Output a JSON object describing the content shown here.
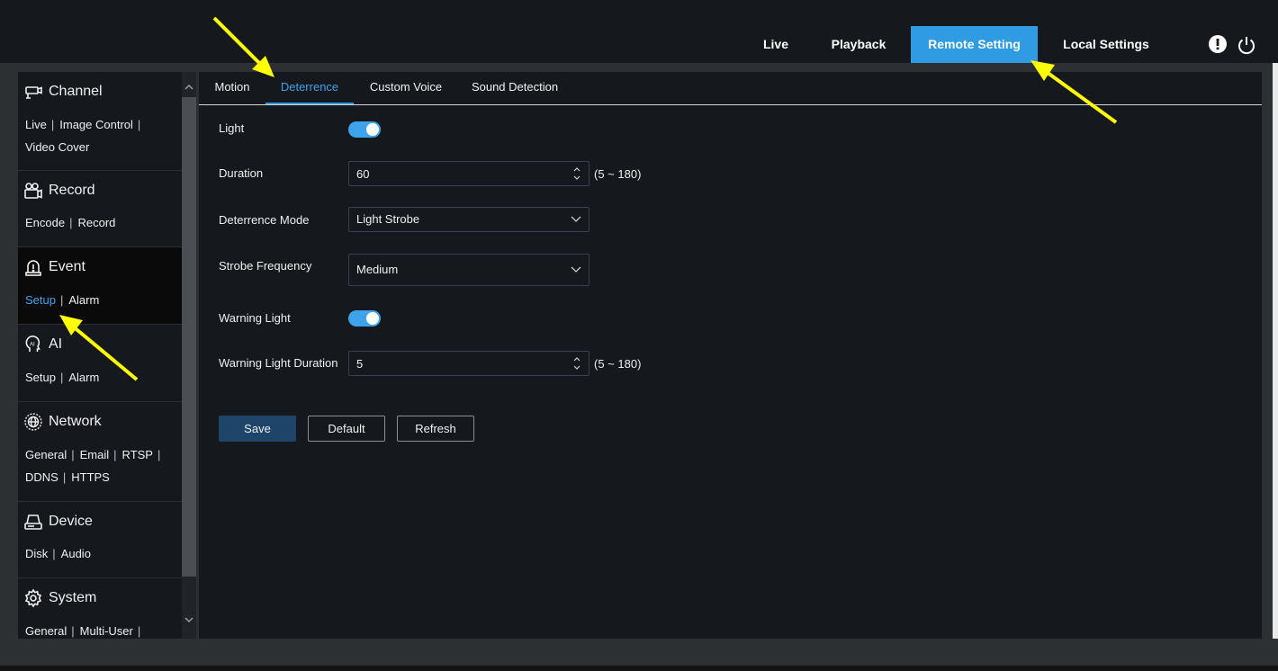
{
  "topnav": {
    "items": [
      {
        "label": "Live"
      },
      {
        "label": "Playback"
      },
      {
        "label": "Remote Setting",
        "active": true
      },
      {
        "label": "Local Settings"
      }
    ],
    "info_icon": "info-icon",
    "power_icon": "power-icon"
  },
  "sidebar": {
    "groups": [
      {
        "title": "Channel",
        "icon": "camera-icon",
        "links": [
          "Live",
          "Image Control",
          "Video Cover"
        ]
      },
      {
        "title": "Record",
        "icon": "record-icon",
        "links": [
          "Encode",
          "Record"
        ]
      },
      {
        "title": "Event",
        "icon": "alarm-light-icon",
        "links": [
          "Setup",
          "Alarm"
        ],
        "active_link": "Setup"
      },
      {
        "title": "AI",
        "icon": "ai-head-icon",
        "links": [
          "Setup",
          "Alarm"
        ]
      },
      {
        "title": "Network",
        "icon": "network-globe-icon",
        "links": [
          "General",
          "Email",
          "RTSP",
          "DDNS",
          "HTTPS"
        ]
      },
      {
        "title": "Device",
        "icon": "hard-disk-icon",
        "links": [
          "Disk",
          "Audio"
        ]
      },
      {
        "title": "System",
        "icon": "gear-icon",
        "links": [
          "General",
          "Multi-User"
        ]
      }
    ]
  },
  "tabs": [
    {
      "label": "Motion"
    },
    {
      "label": "Deterrence",
      "active": true
    },
    {
      "label": "Custom Voice"
    },
    {
      "label": "Sound Detection"
    }
  ],
  "form": {
    "light": {
      "label": "Light",
      "on": true
    },
    "duration": {
      "label": "Duration",
      "value": "60",
      "range": "(5 ~ 180)"
    },
    "deterrence_mode": {
      "label": "Deterrence Mode",
      "value": "Light Strobe"
    },
    "strobe_frequency": {
      "label": "Strobe Frequency",
      "value": "Medium"
    },
    "warning_light": {
      "label": "Warning Light",
      "on": true
    },
    "warning_light_duration": {
      "label": "Warning Light Duration",
      "value": "5",
      "range": "(5 ~ 180)"
    }
  },
  "buttons": {
    "save": "Save",
    "default": "Default",
    "refresh": "Refresh"
  },
  "colors": {
    "accent": "#2f9be3",
    "save_button": "#1e4569",
    "annotation_arrow": "#ffff00"
  }
}
